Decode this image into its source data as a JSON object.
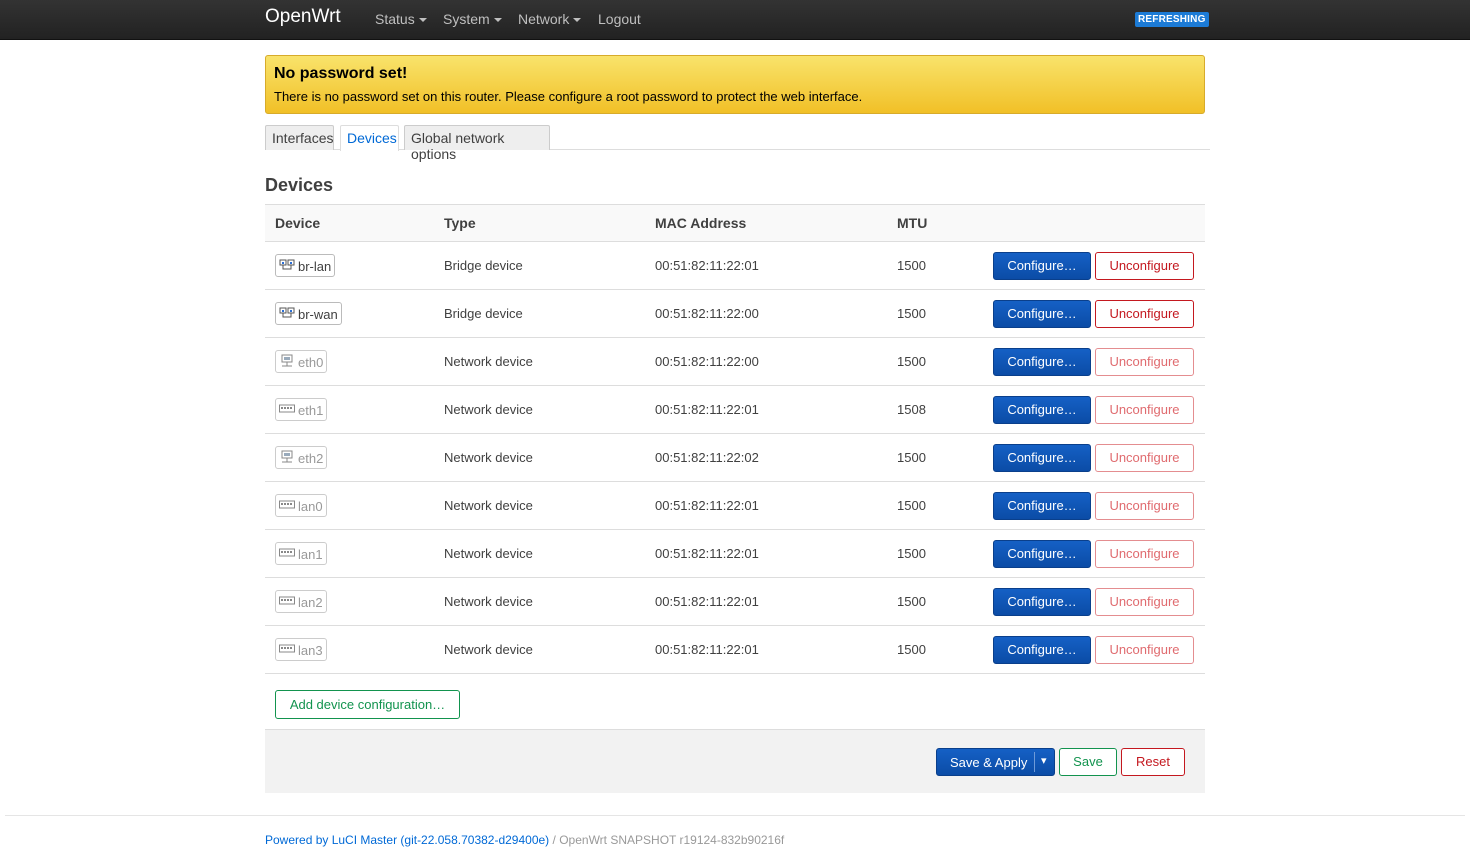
{
  "header": {
    "brand": "OpenWrt",
    "menu": [
      {
        "label": "Status",
        "dropdown": true
      },
      {
        "label": "System",
        "dropdown": true
      },
      {
        "label": "Network",
        "dropdown": true
      },
      {
        "label": "Logout",
        "dropdown": false
      }
    ],
    "status_badge": "REFRESHING"
  },
  "alert": {
    "title": "No password set!",
    "message": "There is no password set on this router. Please configure a root password to protect the web interface."
  },
  "tabs": [
    {
      "label": "Interfaces",
      "active": false
    },
    {
      "label": "Devices",
      "active": true
    },
    {
      "label": "Global network options",
      "active": false
    }
  ],
  "section_title": "Devices",
  "table": {
    "headers": [
      "Device",
      "Type",
      "MAC Address",
      "MTU"
    ],
    "rows": [
      {
        "device": "br-lan",
        "icon": "bridge-icon",
        "dim": false,
        "type": "Bridge device",
        "mac": "00:51:82:11:22:01",
        "mtu": "1500"
      },
      {
        "device": "br-wan",
        "icon": "bridge-icon",
        "dim": false,
        "type": "Bridge device",
        "mac": "00:51:82:11:22:00",
        "mtu": "1500"
      },
      {
        "device": "eth0",
        "icon": "ethernet-icon",
        "dim": true,
        "type": "Network device",
        "mac": "00:51:82:11:22:00",
        "mtu": "1500"
      },
      {
        "device": "eth1",
        "icon": "switch-port-icon",
        "dim": true,
        "type": "Network device",
        "mac": "00:51:82:11:22:01",
        "mtu": "1508"
      },
      {
        "device": "eth2",
        "icon": "ethernet-icon",
        "dim": true,
        "type": "Network device",
        "mac": "00:51:82:11:22:02",
        "mtu": "1500"
      },
      {
        "device": "lan0",
        "icon": "switch-port-icon",
        "dim": true,
        "type": "Network device",
        "mac": "00:51:82:11:22:01",
        "mtu": "1500"
      },
      {
        "device": "lan1",
        "icon": "switch-port-icon",
        "dim": true,
        "type": "Network device",
        "mac": "00:51:82:11:22:01",
        "mtu": "1500"
      },
      {
        "device": "lan2",
        "icon": "switch-port-icon",
        "dim": true,
        "type": "Network device",
        "mac": "00:51:82:11:22:01",
        "mtu": "1500"
      },
      {
        "device": "lan3",
        "icon": "switch-port-icon",
        "dim": true,
        "type": "Network device",
        "mac": "00:51:82:11:22:01",
        "mtu": "1500"
      }
    ],
    "configure_label": "Configure…",
    "unconfigure_label": "Unconfigure"
  },
  "add_button": "Add device configuration…",
  "actions": {
    "save_apply": "Save & Apply",
    "dropdown_arrow": "▾",
    "save": "Save",
    "reset": "Reset"
  },
  "footer": {
    "link": "Powered by LuCI Master (git-22.058.70382-d29400e)",
    "separator": "/",
    "version": "OpenWrt SNAPSHOT r19124-832b90216f"
  },
  "colors": {
    "accent": "#0b4ca6",
    "danger": "#c4181f",
    "success": "#12934e",
    "alert": "#f1c027"
  }
}
